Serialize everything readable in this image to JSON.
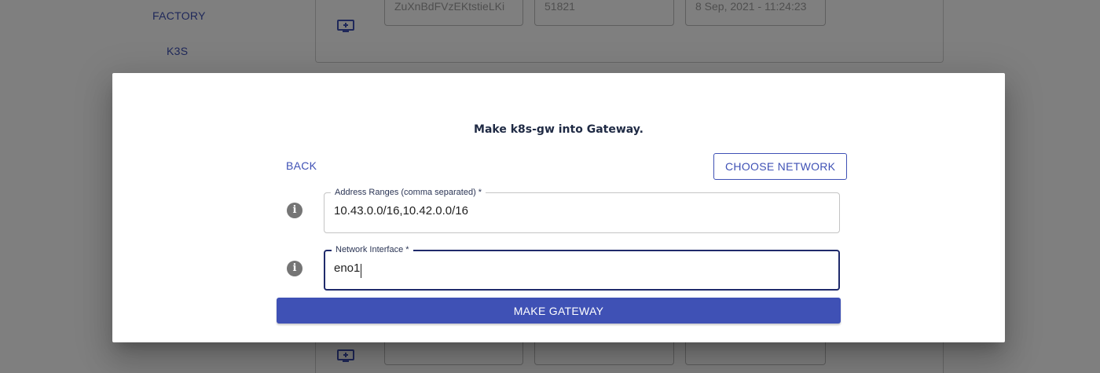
{
  "sidebar": {
    "items": [
      {
        "label": "FACTORY"
      },
      {
        "label": "K3S"
      }
    ]
  },
  "background_rows": [
    {
      "id_value": "ZuXnBdFVzEKtstieLKi",
      "port_value": "51821",
      "date_value": "8 Sep, 2021 - 11:24:23"
    },
    {
      "id_value": "",
      "port_value": "",
      "date_value": ""
    }
  ],
  "dialog": {
    "title": "Make k8s-gw into Gateway.",
    "back_label": "BACK",
    "choose_network_label": "CHOOSE NETWORK",
    "address_ranges": {
      "label": "Address Ranges (comma separated) *",
      "value": "10.43.0.0/16,10.42.0.0/16"
    },
    "network_interface": {
      "label": "Network Interface *",
      "value": "eno1"
    },
    "submit_label": "MAKE GATEWAY"
  },
  "icons": {
    "row_icon": "monitor-add-icon",
    "info": "info-icon"
  },
  "colors": {
    "primary": "#3f51b5",
    "title": "#1f2a44",
    "focus_border": "#1f2a6b",
    "info_icon": "#757575",
    "backdrop": "rgba(0,0,0,0.5)"
  }
}
